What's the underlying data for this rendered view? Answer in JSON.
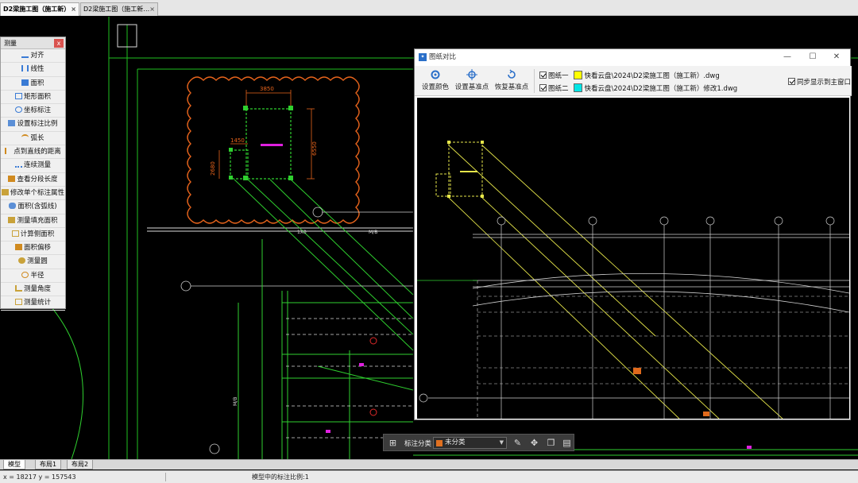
{
  "tabs": [
    {
      "label": "D2梁施工图（施工新）",
      "close": "×",
      "active": true
    },
    {
      "label": "D2梁施工图（施工新…",
      "close": "×",
      "active": false
    }
  ],
  "measure_panel": {
    "title": "测量",
    "close": "x",
    "items": [
      "对齐",
      "线性",
      "面积",
      "矩形面积",
      "坐标标注",
      "设置标注比例",
      "弧长",
      "点到直线的距离",
      "连续测量",
      "查看分段长度",
      "修改单个标注属性",
      "面积(含弧线)",
      "测量填充面积",
      "计算侧面积",
      "面积偏移",
      "测量圆",
      "半径",
      "测量角度",
      "测量统计"
    ]
  },
  "drawing": {
    "dim_top": "3850",
    "dim_right": "6550",
    "dim_small": "1450",
    "dim_left": "2680",
    "label_a": "1X0",
    "label_b": "M/B"
  },
  "compare_window": {
    "title": "图纸对比",
    "buttons": {
      "set_color": "设置颜色",
      "set_base": "设置基准点",
      "restore_base": "恢复基准点"
    },
    "sheet1": {
      "label": "图纸一",
      "file": "快看云盘\\2024\\D2梁施工图（施工新）.dwg",
      "color": "#ffff00"
    },
    "sheet2": {
      "label": "图纸二",
      "file": "快看云盘\\2024\\D2梁施工图（施工新）修改1.dwg",
      "color": "#00e5e5"
    },
    "sync": "同步显示到主窗口",
    "win_controls": {
      "min": "—",
      "max": "☐",
      "close": "✕"
    }
  },
  "annotation_toolbar": {
    "label": "标注分类",
    "selected": "未分类",
    "selected_color": "#e07020"
  },
  "layout_tabs": [
    "模型",
    "布局1",
    "布局2"
  ],
  "status": {
    "coords": "x = 18217 y = 157543",
    "scale": "模型中的标注比例:1"
  }
}
